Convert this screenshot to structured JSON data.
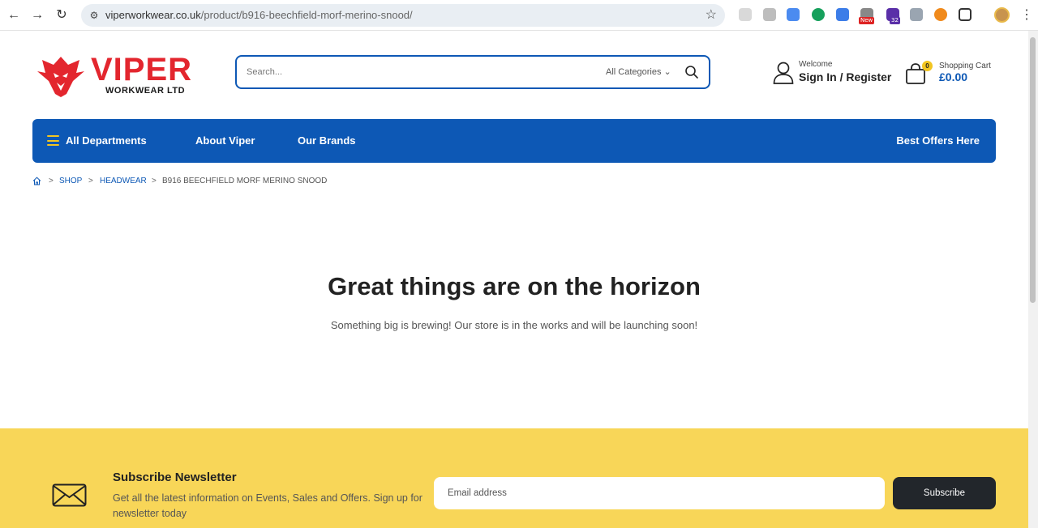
{
  "browser": {
    "url_domain": "viperworkwear.co.uk",
    "url_path": "/product/b916-beechfield-morf-merino-snood/",
    "extension_badges": {
      "new": "New",
      "count": "32"
    }
  },
  "logo": {
    "word": "VIPER",
    "subtitle": "WORKWEAR LTD",
    "brand_color": "#e3262e"
  },
  "search": {
    "placeholder": "Search...",
    "category": "All Categories"
  },
  "account": {
    "welcome": "Welcome",
    "sign_in": "Sign In",
    "separator": "/",
    "register": "Register"
  },
  "cart": {
    "count": "0",
    "label": "Shopping Cart",
    "total": "£0.00"
  },
  "nav": {
    "all_departments": "All Departments",
    "about": "About Viper",
    "brands": "Our Brands",
    "offers": "Best Offers Here",
    "color": "#0d58b5"
  },
  "breadcrumb": {
    "shop": "SHOP",
    "category": "HEADWEAR",
    "current": "B916 BEECHFIELD MORF MERINO SNOOD",
    "separator": ">"
  },
  "hero": {
    "title": "Great things are on the horizon",
    "subtitle": "Something big is brewing! Our store is in the works and will be launching soon!"
  },
  "newsletter": {
    "title": "Subscribe Newsletter",
    "description": "Get all the latest information on Events, Sales and Offers. Sign up for newsletter today",
    "email_placeholder": "Email address",
    "button": "Subscribe",
    "background": "#f8d658"
  }
}
